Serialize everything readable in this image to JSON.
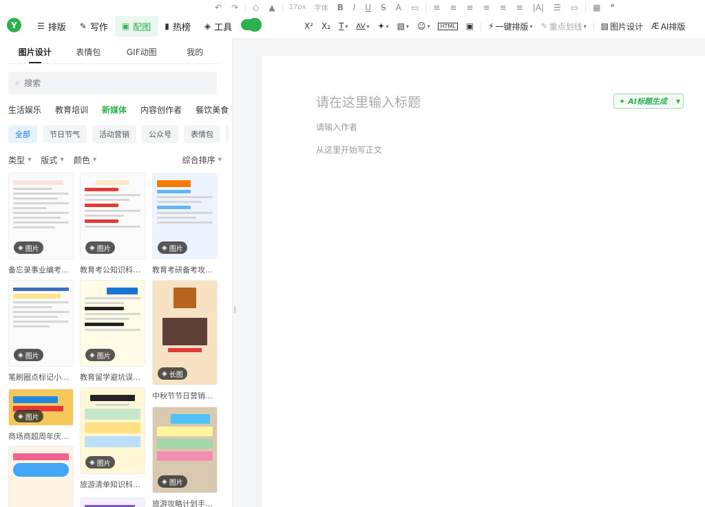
{
  "toolbar_top": {
    "font_size": "17px",
    "font_label": "字体",
    "items": [
      "↶",
      "↷",
      "◇",
      "▲",
      "17px",
      "字体",
      "B",
      "I",
      "U",
      "S",
      "A",
      "▭",
      "≡",
      "≡",
      "≡",
      "≡",
      "≡",
      "≡",
      "|A|",
      "☰",
      "▭",
      "▦",
      "❞"
    ]
  },
  "header": {
    "logo": "Y",
    "tabs": [
      {
        "icon": "☰",
        "label": "排版"
      },
      {
        "icon": "✎",
        "label": "写作"
      },
      {
        "icon": "▣",
        "label": "配图"
      },
      {
        "icon": "▮",
        "label": "热榜"
      },
      {
        "icon": "◈",
        "label": "工具"
      }
    ],
    "tools": {
      "sup": "X²",
      "sub": "X₂",
      "t": "T",
      "av": "AV",
      "wand": "✦",
      "img": "▧",
      "emoji": "☺",
      "html": "HTML",
      "box": "▣",
      "one_key": "一键排版",
      "keypoint": "重点划线",
      "img_design": "图片设计",
      "ai_layout": "AI排版"
    }
  },
  "sidebar": {
    "subtabs": [
      "图片设计",
      "表情包",
      "GIF动图",
      "我的"
    ],
    "search_placeholder": "搜索",
    "categories": [
      "生活娱乐",
      "教育培训",
      "新媒体",
      "内容创作者",
      "餐饮美食"
    ],
    "chips": [
      "全部",
      "节日节气",
      "活动营销",
      "公众号",
      "表情包",
      "通"
    ],
    "filters": {
      "type": "类型",
      "layout": "版式",
      "color": "颜色",
      "sort": "综合排序"
    },
    "cards": [
      {
        "caption": "备忘录事业编考…",
        "badge": "图片"
      },
      {
        "caption": "教育考公知识科…",
        "badge": "图片"
      },
      {
        "caption": "教育考研备考攻…",
        "badge": "图片"
      },
      {
        "caption": "笔刷圈点标记小…",
        "badge": "图片"
      },
      {
        "caption": "教育留学避坑误…",
        "badge": "图片"
      },
      {
        "caption": "中秋节节日营销…",
        "badge": "长图"
      },
      {
        "caption": "商场商超周年庆…",
        "badge": "图片"
      },
      {
        "caption": "旅游清单知识科…",
        "badge": "图片"
      },
      {
        "caption": "旅游攻略计划手…",
        "badge": "图片"
      },
      {
        "caption": "",
        "badge": ""
      },
      {
        "caption": "",
        "badge": ""
      }
    ]
  },
  "editor": {
    "title_placeholder": "请在这里输入标题",
    "author_placeholder": "请输入作者",
    "body_placeholder": "从这里开始写正文",
    "ai_title_button": "AI标题生成"
  },
  "colors": {
    "accent": "#2bb24c",
    "chip_active": "#1a73e8"
  }
}
